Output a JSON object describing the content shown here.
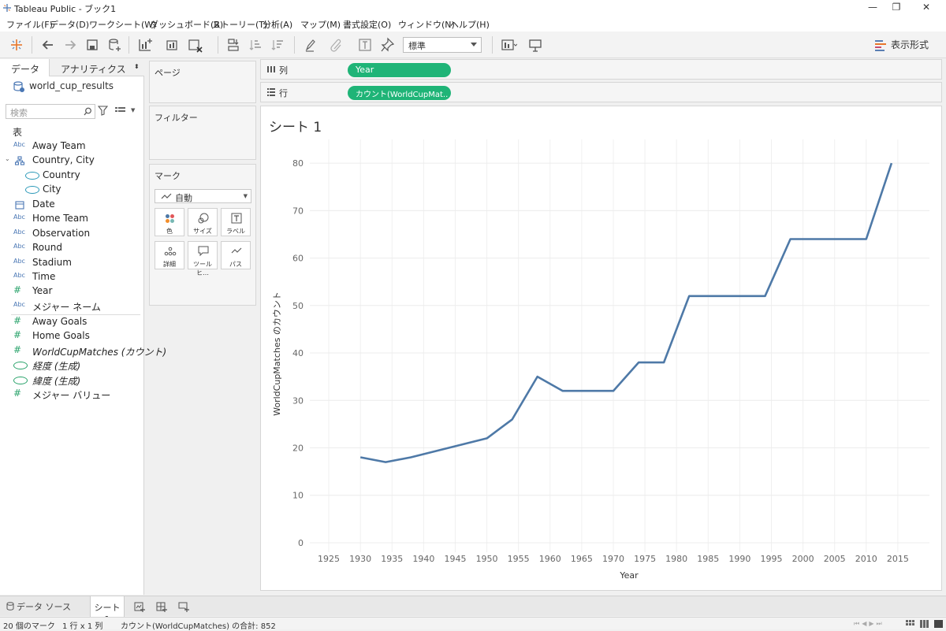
{
  "window": {
    "title": "Tableau Public - ブック1",
    "controls": [
      "—",
      "❐",
      "✕"
    ]
  },
  "menu": [
    "ファイル(F)",
    "データ(D)",
    "ワークシート(W)",
    "ダッシュボード(B)",
    "ストーリー(T)",
    "分析(A)",
    "マップ(M)",
    "書式設定(O)",
    "ウィンドウ(N)",
    "ヘルプ(H)"
  ],
  "toolbar": {
    "fit_value": "標準",
    "show_me_label": "表示形式",
    "icons": [
      "tableau-logo-icon",
      "back-icon",
      "forward-icon",
      "save-icon",
      "new-datasource-icon",
      "new-worksheet-icon",
      "duplicate-icon",
      "clear-sheet-icon",
      "swap-icon",
      "sort-ascending-icon",
      "sort-descending-icon",
      "highlight-icon",
      "group-icon",
      "show-labels-icon",
      "pin-icon",
      "presentation-icon"
    ]
  },
  "data_pane": {
    "tabs": [
      "データ",
      "アナリティクス"
    ],
    "datasource": "world_cup_results",
    "search_placeholder": "検索",
    "section_label": "表",
    "fields": [
      {
        "label": "Away Team",
        "icon": "abc-icon"
      },
      {
        "label": "Country, City",
        "icon": "hierarchy-icon"
      },
      {
        "label": "Country",
        "icon": "globe-icon",
        "child": true
      },
      {
        "label": "City",
        "icon": "globe-icon",
        "child": true
      },
      {
        "label": "Date",
        "icon": "calendar-icon"
      },
      {
        "label": "Home Team",
        "icon": "abc-icon"
      },
      {
        "label": "Observation",
        "icon": "abc-icon"
      },
      {
        "label": "Round",
        "icon": "abc-icon"
      },
      {
        "label": "Stadium",
        "icon": "abc-icon"
      },
      {
        "label": "Time",
        "icon": "abc-icon"
      },
      {
        "label": "Year",
        "icon": "hash-icon"
      },
      {
        "label": "メジャー ネーム",
        "icon": "abc-icon"
      }
    ],
    "measures": [
      {
        "label": "Away Goals",
        "icon": "hash-icon"
      },
      {
        "label": "Home Goals",
        "icon": "hash-icon"
      },
      {
        "label": "WorldCupMatches (カウント)",
        "icon": "hash-icon"
      },
      {
        "label": "経度 (生成)",
        "icon": "globe-icon"
      },
      {
        "label": "緯度 (生成)",
        "icon": "globe-icon"
      },
      {
        "label": "メジャー バリュー",
        "icon": "hash-icon"
      }
    ]
  },
  "cards": {
    "pages": "ページ",
    "filters": "フィルター",
    "marks": "マーク",
    "mark_type": "自動",
    "mark_buttons": [
      "色",
      "サイズ",
      "ラベル",
      "詳細",
      "ツールヒ…",
      "パス"
    ]
  },
  "shelves": {
    "columns_label": "列",
    "rows_label": "行",
    "columns_pill": "Year",
    "rows_pill": "カウント(WorldCupMat.."
  },
  "sheet": {
    "title": "シート 1"
  },
  "chart_data": {
    "type": "line",
    "xlabel": "Year",
    "ylabel": "WorldCupMatches のカウント",
    "x_ticks": [
      1925,
      1930,
      1935,
      1940,
      1945,
      1950,
      1955,
      1960,
      1965,
      1970,
      1975,
      1980,
      1985,
      1990,
      1995,
      2000,
      2005,
      2010,
      2015
    ],
    "y_ticks": [
      0,
      10,
      20,
      30,
      40,
      50,
      60,
      70,
      80
    ],
    "xlim": [
      1922,
      2020
    ],
    "ylim": [
      -2,
      85
    ],
    "grid": true,
    "series": [
      {
        "color": "#4e79a7",
        "x": [
          1930,
          1934,
          1938,
          1950,
          1954,
          1958,
          1962,
          1966,
          1970,
          1974,
          1978,
          1982,
          1986,
          1990,
          1994,
          1998,
          2002,
          2006,
          2010,
          2014
        ],
        "values": [
          18,
          17,
          18,
          22,
          26,
          35,
          32,
          32,
          32,
          38,
          38,
          52,
          52,
          52,
          52,
          64,
          64,
          64,
          64,
          80
        ]
      }
    ]
  },
  "tabbar": {
    "datasource_tab": "データ ソース",
    "sheet_tab": "シート 1"
  },
  "status": {
    "marks": "20 個のマーク",
    "rows_cols": "1 行 x 1 列",
    "sum": "カウント(WorldCupMatches) の合計: 852"
  }
}
